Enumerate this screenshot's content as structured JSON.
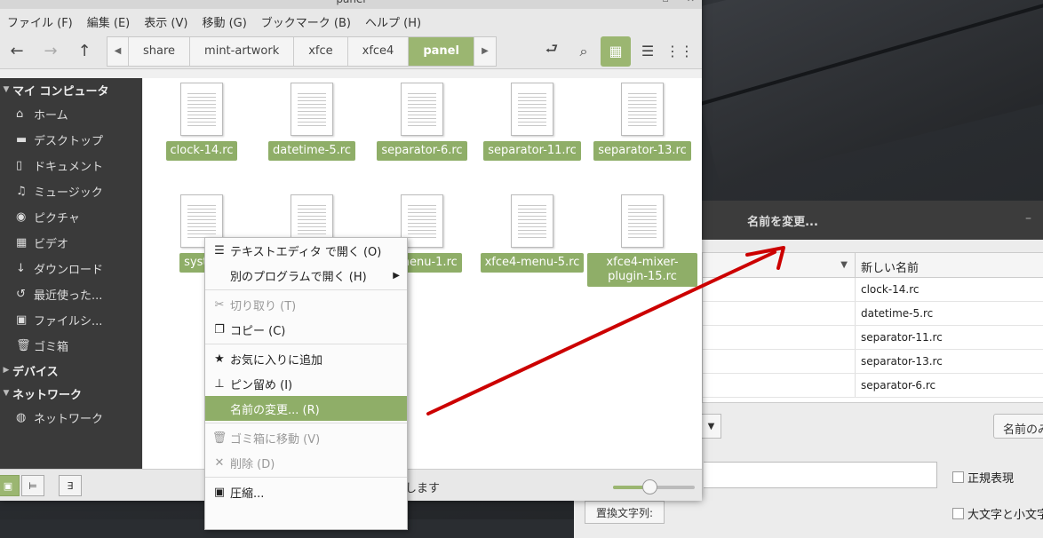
{
  "window": {
    "title": "panel",
    "menus": [
      "ファイル (F)",
      "編集 (E)",
      "表示 (V)",
      "移動 (G)",
      "ブックマーク (B)",
      "ヘルプ (H)"
    ]
  },
  "breadcrumbs": [
    "share",
    "mint-artwork",
    "xfce",
    "xfce4",
    "panel"
  ],
  "sidebar": {
    "my_computer": "マイ コンピュータ",
    "items": [
      {
        "label": "ホーム",
        "icon": "home-icon",
        "glyph": "⌂"
      },
      {
        "label": "デスクトップ",
        "icon": "desktop-icon",
        "glyph": "▬"
      },
      {
        "label": "ドキュメント",
        "icon": "document-icon",
        "glyph": "▯"
      },
      {
        "label": "ミュージック",
        "icon": "music-icon",
        "glyph": "♫"
      },
      {
        "label": "ピクチャ",
        "icon": "camera-icon",
        "glyph": "◉"
      },
      {
        "label": "ビデオ",
        "icon": "video-icon",
        "glyph": "▦"
      },
      {
        "label": "ダウンロード",
        "icon": "download-icon",
        "glyph": "↓"
      },
      {
        "label": "最近使った...",
        "icon": "recent-icon",
        "glyph": "↺"
      },
      {
        "label": "ファイルシ...",
        "icon": "filesystem-icon",
        "glyph": "▣"
      },
      {
        "label": "ゴミ箱",
        "icon": "trash-icon",
        "glyph": "🗑"
      }
    ],
    "devices": "デバイス",
    "network": "ネットワーク",
    "network_items": [
      {
        "label": "ネットワーク",
        "icon": "network-icon",
        "glyph": "◍"
      }
    ]
  },
  "files": [
    {
      "name": "clock-14.rc"
    },
    {
      "name": "datetime-5.rc"
    },
    {
      "name": "separator-6.rc"
    },
    {
      "name": "separator-11.rc"
    },
    {
      "name": "separator-13.rc"
    },
    {
      "name": "systra"
    },
    {
      "name": ""
    },
    {
      "name": "ermenu-1.rc"
    },
    {
      "name": "xfce4-menu-5.rc"
    },
    {
      "name": "xfce4-mixer-plugin-15.rc"
    }
  ],
  "context_menu": [
    {
      "label": "テキストエディタ で開く (O)",
      "icon": "text-editor-icon",
      "glyph": "☰",
      "disabled": false
    },
    {
      "label": "別のプログラムで開く (H)",
      "icon": "",
      "glyph": "",
      "submenu": true,
      "disabled": false
    },
    {
      "sep": true
    },
    {
      "label": "切り取り (T)",
      "icon": "cut-icon",
      "glyph": "✂",
      "disabled": true
    },
    {
      "label": "コピー (C)",
      "icon": "copy-icon",
      "glyph": "❐",
      "disabled": false
    },
    {
      "sep": true
    },
    {
      "label": "お気に入りに追加",
      "icon": "favorite-icon",
      "glyph": "★",
      "disabled": false
    },
    {
      "label": "ピン留め (I)",
      "icon": "pin-icon",
      "glyph": "⊥",
      "disabled": false
    },
    {
      "label": "名前の変更... (R)",
      "icon": "",
      "glyph": "",
      "disabled": false,
      "highlight": true
    },
    {
      "sep": true
    },
    {
      "label": "ゴミ箱に移動 (V)",
      "icon": "trash-icon",
      "glyph": "🗑",
      "disabled": true
    },
    {
      "label": "削除 (D)",
      "icon": "delete-icon",
      "glyph": "✕",
      "disabled": true
    },
    {
      "sep": true
    },
    {
      "label": "圧縮...",
      "icon": "compress-icon",
      "glyph": "▣",
      "disabled": false
    }
  ],
  "status": {
    "text": "します",
    "zoom": 0.45
  },
  "rename_dialog": {
    "title": "名前を変更...",
    "new_name_header": "新しい名前",
    "rows": [
      "clock-14.rc",
      "datetime-5.rc",
      "separator-11.rc",
      "separator-13.rc",
      "separator-6.rc"
    ],
    "button": "名前のみ",
    "regex": "正規表現",
    "replace_label": "置換文字列:",
    "case_label": "大文字と小文字"
  },
  "colors": {
    "accent": "#9bb671",
    "arrow": "#cc0000"
  }
}
